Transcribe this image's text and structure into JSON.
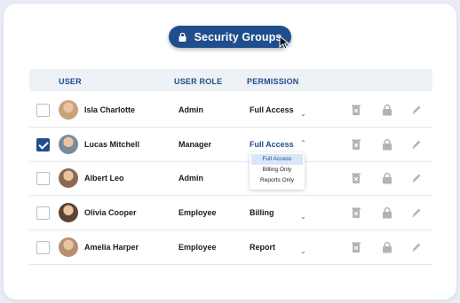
{
  "header": {
    "title": "Security Groups"
  },
  "table": {
    "columns": {
      "user": "USER",
      "role": "USER ROLE",
      "permission": "PERMISSION"
    },
    "rows": [
      {
        "name": "Isla Charlotte",
        "role": "Admin",
        "permission": "Full Access",
        "checked": false,
        "avatar_bg": "#c9a27a"
      },
      {
        "name": "Lucas Mitchell",
        "role": "Manager",
        "permission": "Full Access",
        "checked": true,
        "avatar_bg": "#7a8a9a"
      },
      {
        "name": "Albert Leo",
        "role": "Admin",
        "permission": "",
        "checked": false,
        "avatar_bg": "#8a6a50"
      },
      {
        "name": "Olivia Cooper",
        "role": "Employee",
        "permission": "Billing",
        "checked": false,
        "avatar_bg": "#5a4535"
      },
      {
        "name": "Amelia Harper",
        "role": "Employee",
        "permission": "Report",
        "checked": false,
        "avatar_bg": "#b89070"
      }
    ]
  },
  "dropdown": {
    "options": [
      "Full Access",
      "Billing Only",
      "Reports Only"
    ],
    "selected": "Full Access"
  },
  "colors": {
    "accent": "#1f4e8c",
    "icon_gray": "#b3b3b3"
  }
}
